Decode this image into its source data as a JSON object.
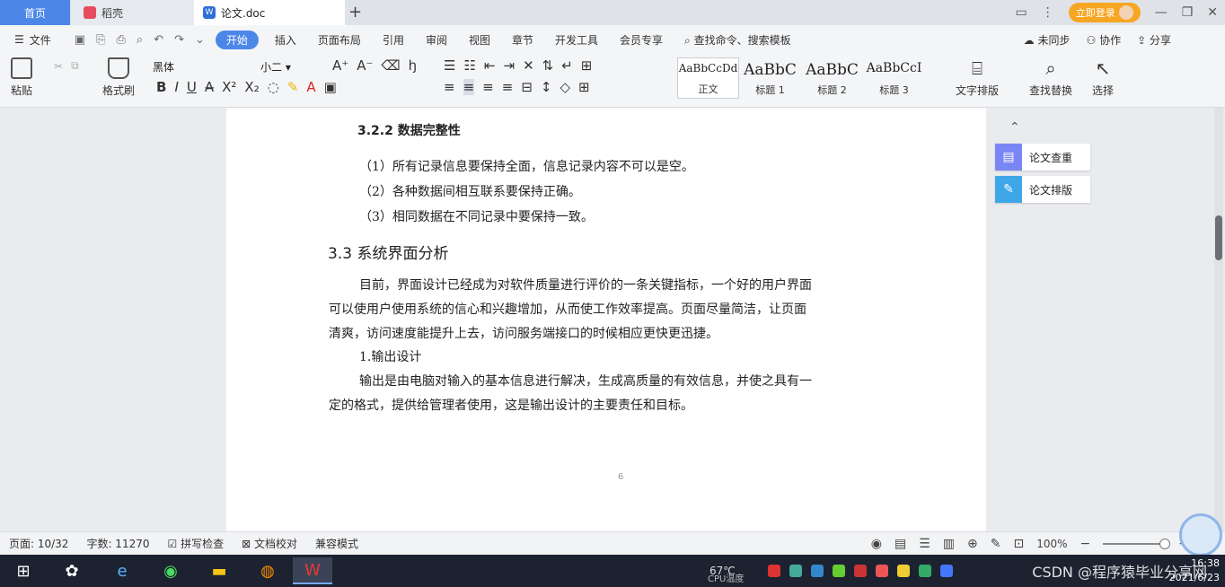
{
  "tabs": {
    "home": "首页",
    "docer": "稻壳",
    "doc": "论文.doc",
    "new_tab": "+"
  },
  "account": {
    "vip_label": "立即登录"
  },
  "menu": {
    "file": "文件",
    "items": [
      "开始",
      "插入",
      "页面布局",
      "引用",
      "审阅",
      "视图",
      "章节",
      "开发工具",
      "会员专享"
    ],
    "search_cmd": "查找命令、搜索模板",
    "sync": "未同步",
    "collab": "协作",
    "share": "分享"
  },
  "ribbon": {
    "paste": "粘贴",
    "format_painter": "格式刷",
    "font_name": "黑体",
    "font_size": "小二",
    "styles": [
      {
        "sample": "AaBbCcDd",
        "name": "正文"
      },
      {
        "sample": "AaBbC",
        "name": "标题 1"
      },
      {
        "sample": "AaBbC",
        "name": "标题 2"
      },
      {
        "sample": "AaBbCcI",
        "name": "标题 3"
      }
    ],
    "text_layout": "文字排版",
    "find_replace": "查找替换",
    "select": "选择"
  },
  "document": {
    "h_322": "3.2.2  数据完整性",
    "items": [
      "（1）所有记录信息要保持全面，信息记录内容不可以是空。",
      "（2）各种数据间相互联系要保持正确。",
      "（3）相同数据在不同记录中要保持一致。"
    ],
    "h_33": "3.3 系统界面分析",
    "para1": [
      "目前，界面设计已经成为对软件质量进行评价的一条关键指标，一个好的用户界面",
      "可以使用户使用系统的信心和兴趣增加，从而使工作效率提高。页面尽量简洁，让页面",
      "清爽，访问速度能提升上去，访问服务端接口的时候相应更快更迅捷。"
    ],
    "sub1": "1.输出设计",
    "para2": [
      "输出是由电脑对输入的基本信息进行解决，生成高质量的有效信息，并使之具有一",
      "定的格式，提供给管理者使用，这是输出设计的主要责任和目标。"
    ],
    "page_number": "6"
  },
  "side_panel": {
    "check": "论文查重",
    "layout": "论文排版"
  },
  "status": {
    "page": "页面: 10/32",
    "words": "字数: 11270",
    "spell": "拼写检查",
    "proof": "文档校对",
    "compat": "兼容模式",
    "zoom": "100%"
  },
  "taskbar": {
    "cpu_temp": "67℃",
    "cpu_label": "CPU温度",
    "watermark": "CSDN @程序猿毕业分享网",
    "time": "16:38",
    "date": "2021/6/23"
  },
  "colors": {
    "accent": "#4c87e8",
    "vip": "#f6a623",
    "sidepanel_icon": "#7b86f5"
  }
}
